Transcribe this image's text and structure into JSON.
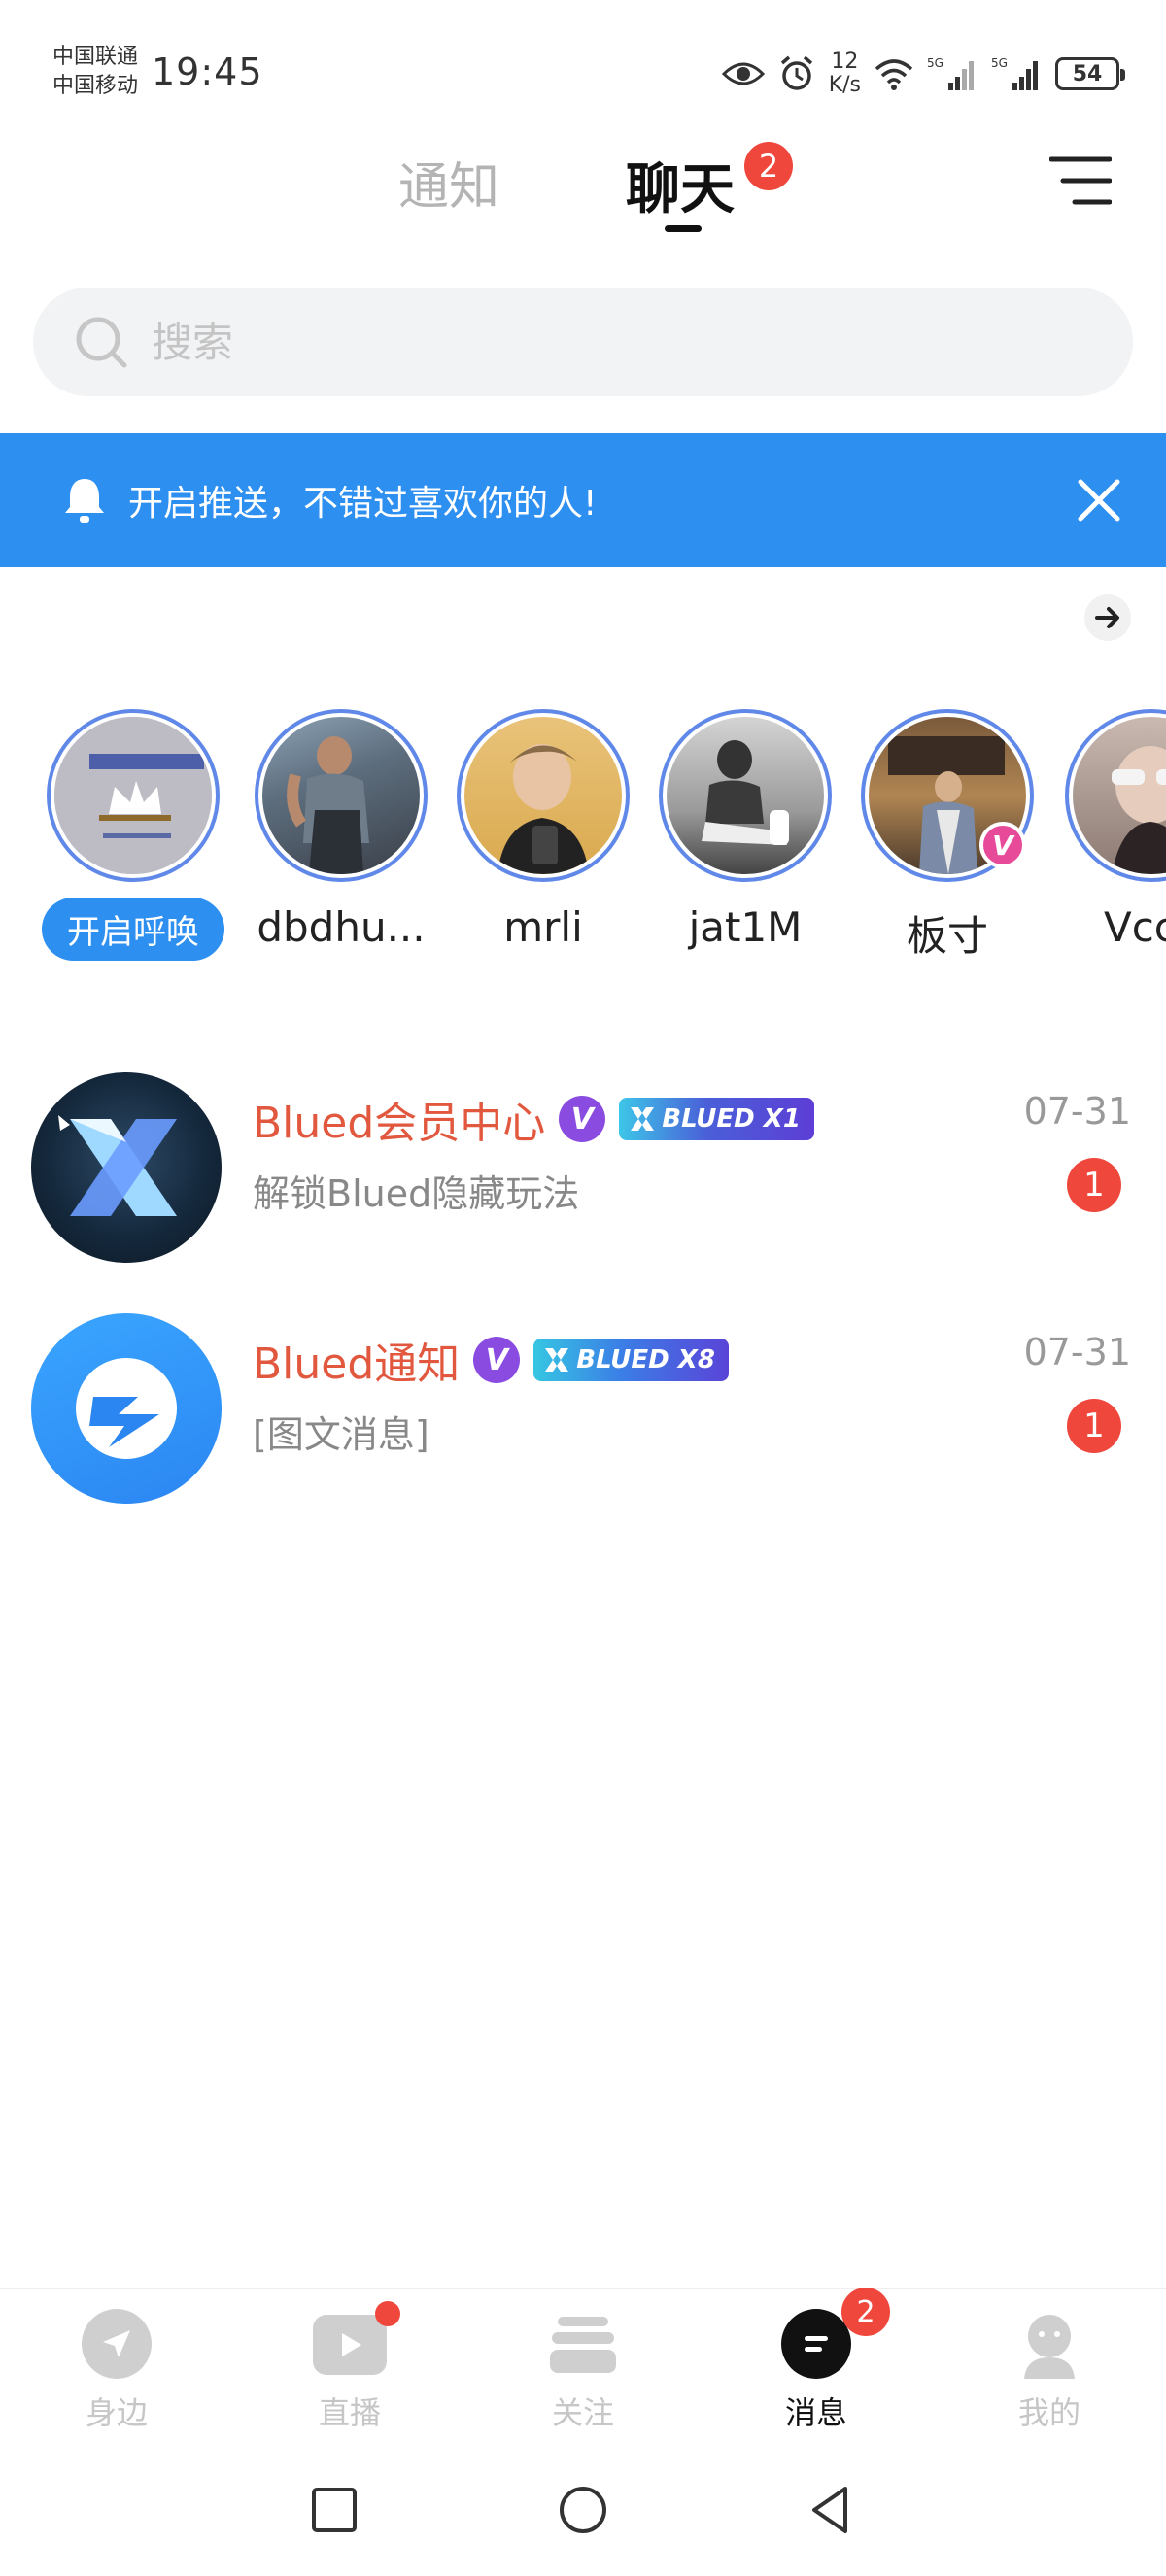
{
  "status_bar": {
    "carrier_1": "中国联通",
    "carrier_2": "中国移动",
    "time": "19:45",
    "speed_value": "12",
    "speed_unit": "K/s",
    "battery": "54"
  },
  "top_tabs": {
    "notice": "通知",
    "chat": "聊天",
    "chat_badge": "2"
  },
  "search": {
    "placeholder": "搜索"
  },
  "push_banner": {
    "text": "开启推送，不错过喜欢你的人!"
  },
  "stories": {
    "call_button": "开启呼唤",
    "items": [
      {
        "name": "dbdhu..."
      },
      {
        "name": "mrli"
      },
      {
        "name": "jat1M"
      },
      {
        "name": "板寸"
      },
      {
        "name": "Vccc"
      }
    ]
  },
  "chats": [
    {
      "name": "Blued会员中心",
      "badge": "V",
      "tag": "BLUED X1",
      "preview": "解锁Blued隐藏玩法",
      "time": "07-31",
      "unread": "1"
    },
    {
      "name": "Blued通知",
      "badge": "V",
      "tag": "BLUED X8",
      "preview": "[图文消息]",
      "time": "07-31",
      "unread": "1"
    }
  ],
  "bottom_nav": {
    "items": [
      {
        "label": "身边"
      },
      {
        "label": "直播"
      },
      {
        "label": "关注"
      },
      {
        "label": "消息",
        "badge": "2"
      },
      {
        "label": "我的"
      }
    ]
  },
  "colors": {
    "accent_blue": "#2d8ff0",
    "badge_red": "#f0473d",
    "name_orange": "#e2583e",
    "vip_purple": "#8a4ce0"
  }
}
